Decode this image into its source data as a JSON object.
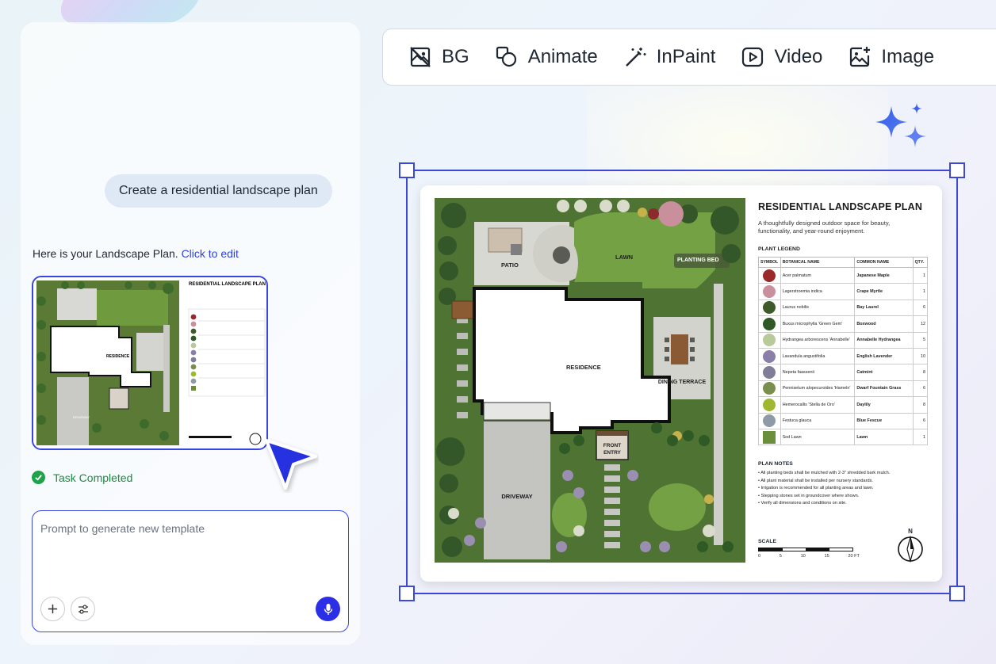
{
  "chat": {
    "user_message": "Create a residential landscape plan",
    "reply_prefix": "Here is your Landscape Plan.",
    "reply_link": "Click to edit",
    "task_status": "Task Completed",
    "prompt_placeholder": "Prompt to generate new template"
  },
  "toolbar": {
    "items": [
      {
        "label": "BG",
        "icon": "bg-remove-icon"
      },
      {
        "label": "Animate",
        "icon": "animate-icon"
      },
      {
        "label": "InPaint",
        "icon": "magic-wand-icon"
      },
      {
        "label": "Video",
        "icon": "video-icon"
      },
      {
        "label": "Image",
        "icon": "image-add-icon"
      }
    ]
  },
  "plan": {
    "title": "RESIDENTIAL LANDSCAPE PLAN",
    "subtitle": "A thoughtfully designed outdoor space for beauty, functionality, and year-round enjoyment.",
    "legend_heading": "PLANT LEGEND",
    "columns": [
      "SYMBOL",
      "BOTANICAL NAME",
      "COMMON NAME",
      "QTY."
    ],
    "plants": [
      {
        "botanical": "Acer palmatum",
        "common": "Japanese Maple",
        "qty": "1",
        "color": "#9a2a2a"
      },
      {
        "botanical": "Lagerstroemia indica",
        "common": "Crape Myrtle",
        "qty": "1",
        "color": "#c98f9d"
      },
      {
        "botanical": "Laurus nobilis",
        "common": "Bay Laurel",
        "qty": "6",
        "color": "#3f5a2a"
      },
      {
        "botanical": "Buxus microphylla 'Green Gem'",
        "common": "Boxwood",
        "qty": "12",
        "color": "#2f5a25"
      },
      {
        "botanical": "Hydrangea arborescens 'Annabelle'",
        "common": "Annabelle Hydrangea",
        "qty": "5",
        "color": "#b8c99a"
      },
      {
        "botanical": "Lavandula angustifolia",
        "common": "English Lavender",
        "qty": "10",
        "color": "#8a7fa8"
      },
      {
        "botanical": "Nepeta faassenii",
        "common": "Catmint",
        "qty": "8",
        "color": "#7f7d98"
      },
      {
        "botanical": "Pennisetum alopecuroides 'Hameln'",
        "common": "Dwarf Fountain Grass",
        "qty": "6",
        "color": "#7a8e4e"
      },
      {
        "botanical": "Hemerocallis 'Stella de Oro'",
        "common": "Daylily",
        "qty": "8",
        "color": "#9fb82f"
      },
      {
        "botanical": "Festuca glauca",
        "common": "Blue Fescue",
        "qty": "6",
        "color": "#8e9aa5"
      },
      {
        "botanical": "Sod Lawn",
        "common": "Lawn",
        "qty": "1",
        "color": "#6b8e3a"
      }
    ],
    "notes_heading": "PLAN NOTES",
    "notes": [
      "• All planting beds shall be mulched with 2-3\" shredded bark mulch.",
      "• All plant material shall be installed per nursery standards.",
      "• Irrigation is recommended for all planting areas and lawn.",
      "• Stepping stones set in groundcover where shown.",
      "• Verify all dimensions and conditions on site."
    ],
    "scale_label": "SCALE",
    "scale_ticks": [
      "0",
      "5",
      "10",
      "15",
      "20 FT"
    ],
    "compass_label": "N",
    "areas": {
      "patio": "PATIO",
      "lawn": "LAWN",
      "planting_bed": "PLANTING BED",
      "residence": "RESIDENCE",
      "dining_terrace": "DINING TERRACE",
      "driveway": "DRIVEWAY",
      "front_entry": "FRONT ENTRY"
    }
  }
}
